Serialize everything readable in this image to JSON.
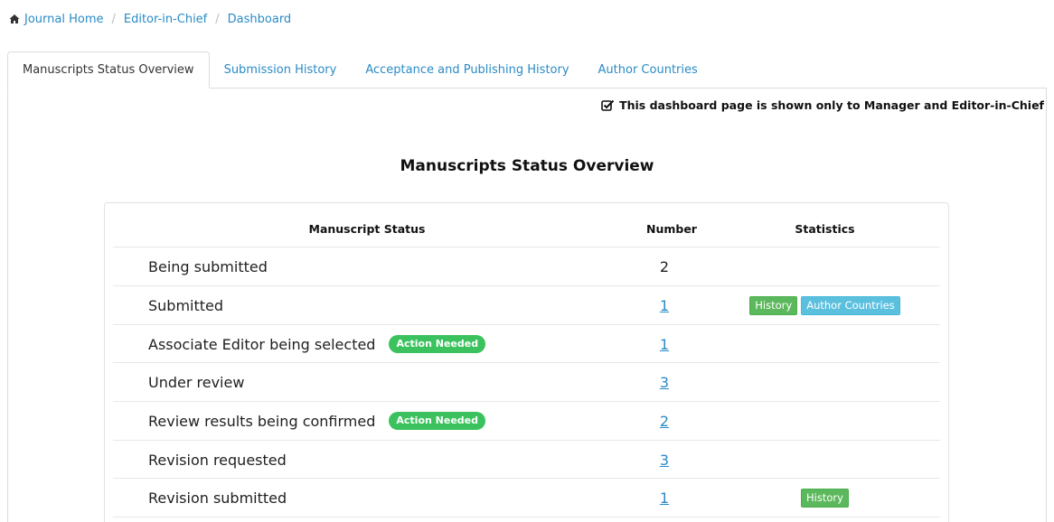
{
  "breadcrumb": {
    "items": [
      "Journal Home",
      "Editor-in-Chief",
      "Dashboard"
    ],
    "separator": "/"
  },
  "tabs": [
    "Manuscripts Status Overview",
    "Submission History",
    "Acceptance and Publishing History",
    "Author Countries"
  ],
  "notice": "This dashboard page is shown only to Manager and Editor-in-Chief",
  "title": "Manuscripts Status Overview",
  "table": {
    "headers": [
      "Manuscript Status",
      "Number",
      "Statistics"
    ],
    "rows": [
      {
        "label": "Being submitted",
        "number": "2",
        "badge": "",
        "stats": []
      },
      {
        "label": "Submitted",
        "number": "1",
        "badge": "",
        "stats": [
          "History",
          "Author Countries"
        ]
      },
      {
        "label": "Associate Editor being selected",
        "number": "1",
        "badge": "Action Needed",
        "stats": []
      },
      {
        "label": "Under review",
        "number": "3",
        "badge": "",
        "stats": []
      },
      {
        "label": "Review results being confirmed",
        "number": "2",
        "badge": "Action Needed",
        "stats": []
      },
      {
        "label": "Revision requested",
        "number": "3",
        "badge": "",
        "stats": []
      },
      {
        "label": "Revision submitted",
        "number": "1",
        "badge": "",
        "stats": [
          "History"
        ]
      }
    ]
  },
  "colors": {
    "link": "#2a8bc6",
    "action_badge": "#3bc25e",
    "history_button": "#5cb85c",
    "countries_button": "#5bc0de"
  },
  "icons": {
    "breadcrumb_home": "home-icon",
    "notice": "checkbox-checked-icon"
  }
}
